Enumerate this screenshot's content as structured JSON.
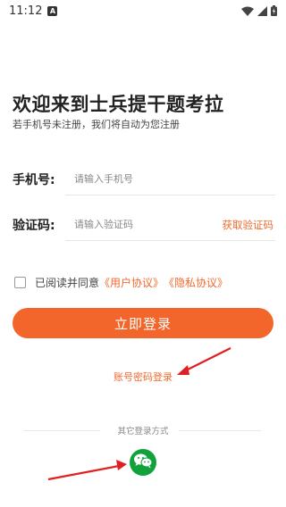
{
  "status_bar": {
    "time": "11:12",
    "notification_icon": "A"
  },
  "header": {
    "title": "欢迎来到士兵提干题考拉",
    "subtitle": "若手机号未注册，我们将自动为您注册"
  },
  "form": {
    "phone_label": "手机号:",
    "phone_placeholder": "请输入手机号",
    "code_label": "验证码:",
    "code_placeholder": "请输入验证码",
    "get_code": "获取验证码"
  },
  "agreement": {
    "prefix": "已阅读并同意",
    "user_agreement": "《用户协议》",
    "privacy_agreement": "《隐私协议》"
  },
  "login_button": "立即登录",
  "password_login": "账号密码登录",
  "other_login": {
    "label": "其它登录方式",
    "wechat_icon": "wechat-icon"
  },
  "colors": {
    "accent": "#f2662b",
    "link": "#f26a2e",
    "wechat": "#12a23c",
    "annotation_arrow": "#e02020"
  }
}
